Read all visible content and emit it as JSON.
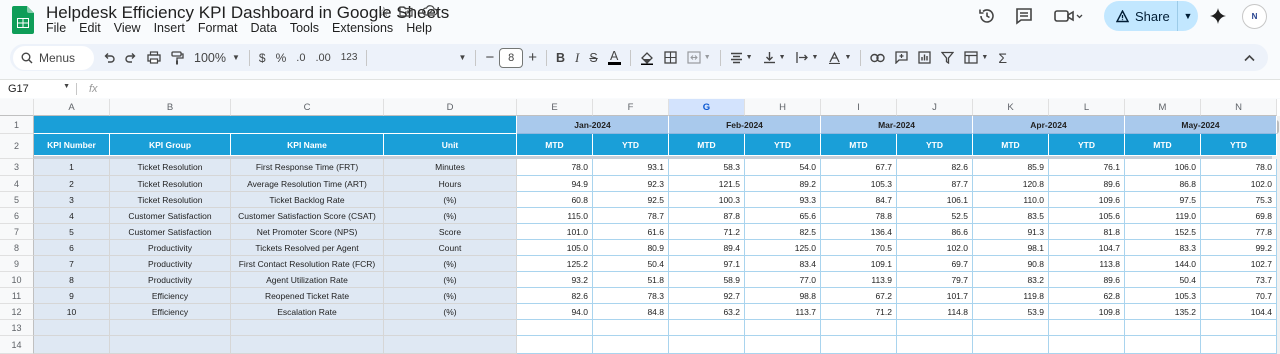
{
  "doc": {
    "title": "Helpdesk Efficiency KPI Dashboard in Google Sheets",
    "menus": [
      "File",
      "Edit",
      "View",
      "Insert",
      "Format",
      "Data",
      "Tools",
      "Extensions",
      "Help"
    ],
    "share_label": "Share",
    "avatar_text": "N"
  },
  "toolbar": {
    "search_label": "Menus",
    "zoom": "100%",
    "currency": "$",
    "percent": "%",
    "dec_decrease": ".0",
    "dec_increase": ".00",
    "number_format": "123",
    "font_size": "8"
  },
  "formula_bar": {
    "cell_ref": "G17",
    "fx_label": "fx",
    "content": ""
  },
  "columns": [
    "A",
    "B",
    "C",
    "D",
    "E",
    "F",
    "G",
    "H",
    "I",
    "J",
    "K",
    "L",
    "M",
    "N"
  ],
  "selected_column": "G",
  "rows": [
    "1",
    "2",
    "3",
    "4",
    "5",
    "6",
    "7",
    "8",
    "9",
    "10",
    "11",
    "12",
    "13",
    "14"
  ],
  "table": {
    "headers": [
      "KPI Number",
      "KPI Group",
      "KPI Name",
      "Unit"
    ],
    "months": [
      "Jan-2024",
      "Feb-2024",
      "Mar-2024",
      "Apr-2024",
      "May-2024"
    ],
    "subheaders": [
      "MTD",
      "YTD"
    ],
    "kpis": [
      {
        "num": "1",
        "group": "Ticket Resolution",
        "name": "First Response Time (FRT)",
        "unit": "Minutes",
        "values": [
          "78.0",
          "93.1",
          "58.3",
          "54.0",
          "67.7",
          "82.6",
          "85.9",
          "76.1",
          "106.0",
          "78.0"
        ]
      },
      {
        "num": "2",
        "group": "Ticket Resolution",
        "name": "Average Resolution Time (ART)",
        "unit": "Hours",
        "values": [
          "94.9",
          "92.3",
          "121.5",
          "89.2",
          "105.3",
          "87.7",
          "120.8",
          "89.6",
          "86.8",
          "102.0"
        ]
      },
      {
        "num": "3",
        "group": "Ticket Resolution",
        "name": "Ticket Backlog Rate",
        "unit": "(%)",
        "values": [
          "60.8",
          "92.5",
          "100.3",
          "93.3",
          "84.7",
          "106.1",
          "110.0",
          "109.6",
          "97.5",
          "75.3"
        ]
      },
      {
        "num": "4",
        "group": "Customer Satisfaction",
        "name": "Customer Satisfaction Score (CSAT)",
        "unit": "(%)",
        "values": [
          "115.0",
          "78.7",
          "87.8",
          "65.6",
          "78.8",
          "52.5",
          "83.5",
          "105.6",
          "119.0",
          "69.8"
        ]
      },
      {
        "num": "5",
        "group": "Customer Satisfaction",
        "name": "Net Promoter Score (NPS)",
        "unit": "Score",
        "values": [
          "101.0",
          "61.6",
          "71.2",
          "82.5",
          "136.4",
          "86.6",
          "91.3",
          "81.8",
          "152.5",
          "77.8"
        ]
      },
      {
        "num": "6",
        "group": "Productivity",
        "name": "Tickets Resolved per Agent",
        "unit": "Count",
        "values": [
          "105.0",
          "80.9",
          "89.4",
          "125.0",
          "70.5",
          "102.0",
          "98.1",
          "104.7",
          "83.3",
          "99.2"
        ]
      },
      {
        "num": "7",
        "group": "Productivity",
        "name": "First Contact Resolution Rate (FCR)",
        "unit": "(%)",
        "values": [
          "125.2",
          "50.4",
          "97.1",
          "83.4",
          "109.1",
          "69.7",
          "90.8",
          "113.8",
          "144.0",
          "102.7"
        ]
      },
      {
        "num": "8",
        "group": "Productivity",
        "name": "Agent Utilization Rate",
        "unit": "(%)",
        "values": [
          "93.2",
          "51.8",
          "58.9",
          "77.0",
          "113.9",
          "79.7",
          "83.2",
          "89.6",
          "50.4",
          "73.7"
        ]
      },
      {
        "num": "9",
        "group": "Efficiency",
        "name": "Reopened Ticket Rate",
        "unit": "(%)",
        "values": [
          "82.6",
          "78.3",
          "92.7",
          "98.8",
          "67.2",
          "101.7",
          "119.8",
          "62.8",
          "105.3",
          "70.7"
        ]
      },
      {
        "num": "10",
        "group": "Efficiency",
        "name": "Escalation Rate",
        "unit": "(%)",
        "values": [
          "94.0",
          "84.8",
          "63.2",
          "113.7",
          "71.2",
          "114.8",
          "53.9",
          "109.8",
          "135.2",
          "104.4"
        ]
      }
    ]
  }
}
